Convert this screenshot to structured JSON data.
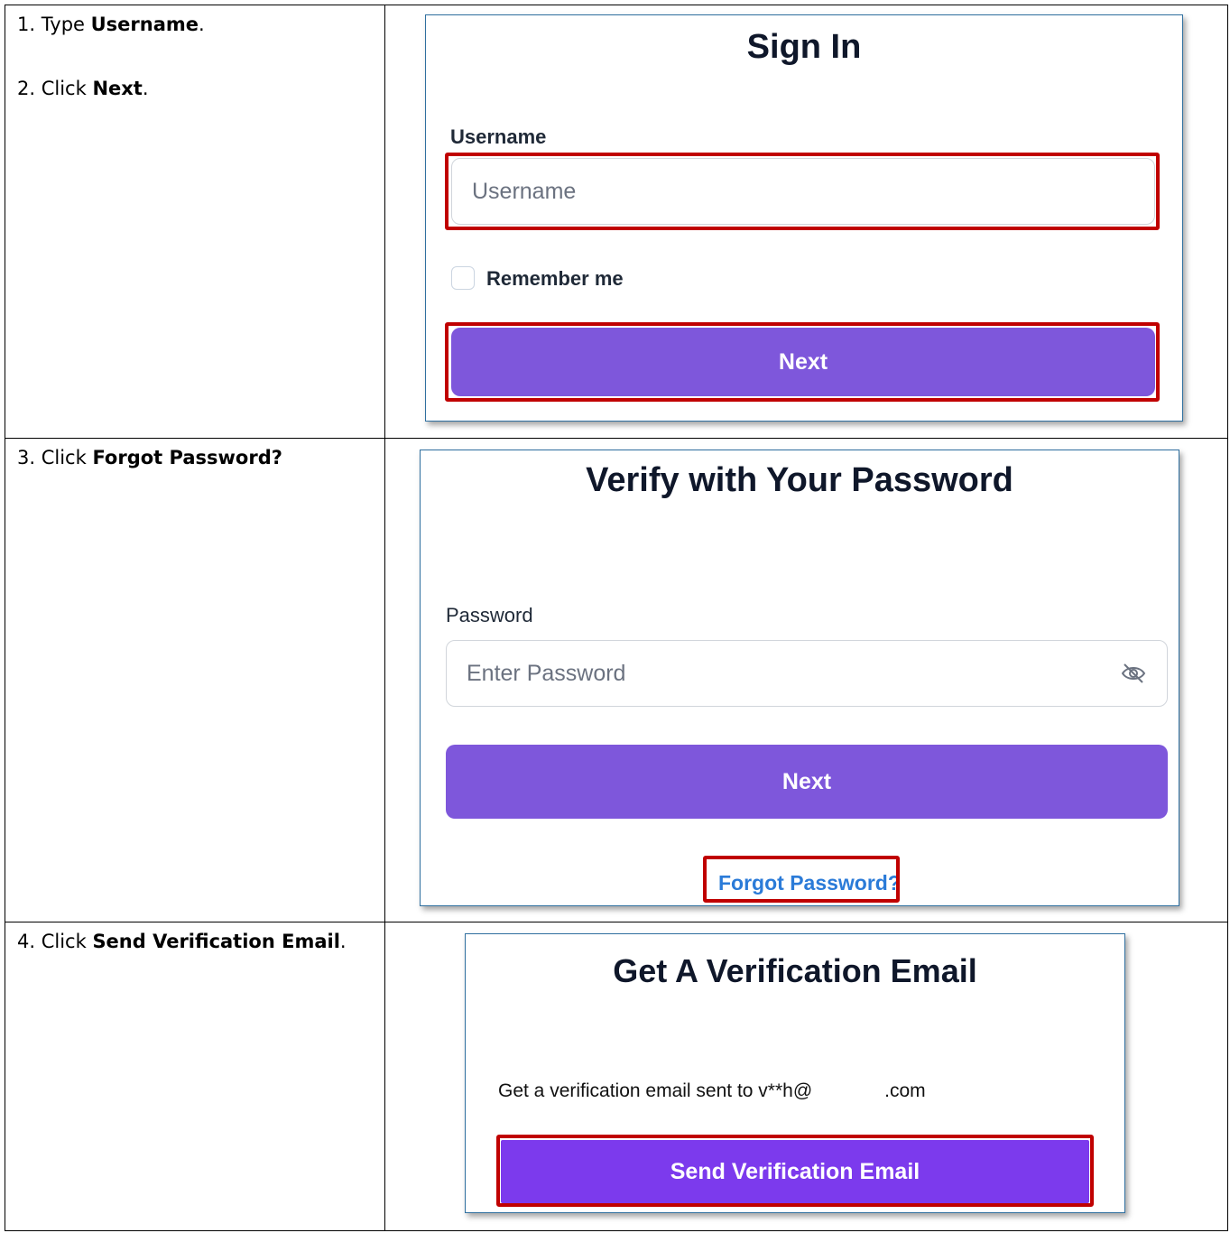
{
  "steps": [
    {
      "prefix": "1. Type ",
      "bold": "Username",
      "suffix": "."
    },
    {
      "prefix": "2. Click ",
      "bold": "Next",
      "suffix": "."
    },
    {
      "prefix": "3. Click ",
      "bold": "Forgot Password?",
      "suffix": ""
    },
    {
      "prefix": "4. Click ",
      "bold": "Send Verification Email",
      "suffix": "."
    }
  ],
  "sign_in": {
    "title": "Sign In",
    "username_label": "Username",
    "username_placeholder": "Username",
    "remember_label": "Remember me",
    "next_label": "Next"
  },
  "verify_password": {
    "title": "Verify with Your Password",
    "password_label": "Password",
    "password_placeholder": "Enter Password",
    "next_label": "Next",
    "forgot_label": "Forgot Password?"
  },
  "verification_email": {
    "title": "Get A Verification Email",
    "message_prefix": "Get a verification email sent to v**h@",
    "message_suffix": ".com",
    "send_label": "Send Verification Email"
  },
  "colors": {
    "button": "#7e57db",
    "send_button": "#7c3aed",
    "highlight": "#c00000",
    "link": "#2b7bd8",
    "card_border": "#2f6f9f"
  },
  "icons": {
    "password_visibility": "eye-off-icon"
  }
}
